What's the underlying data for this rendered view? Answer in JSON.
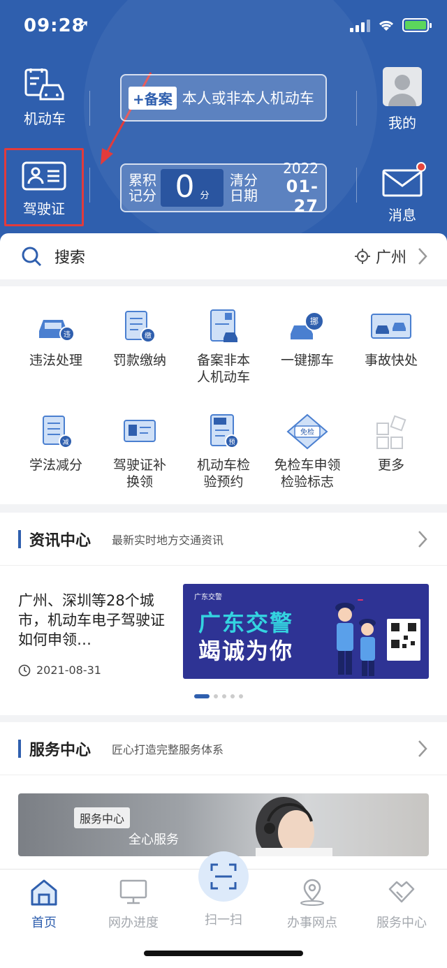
{
  "status_bar": {
    "time": "09:28"
  },
  "header": {
    "vehicle_label": "机动车",
    "license_label": "驾驶证",
    "register_tag": "+备案",
    "register_text": "本人或非本人机动车",
    "score_label_1": "累积",
    "score_label_2": "记分",
    "score_value": "0",
    "score_unit": "分",
    "clear_label_1": "清分",
    "clear_label_2": "日期",
    "clear_year": "2022",
    "clear_date": "01-27",
    "mine_label": "我的",
    "message_label": "消息"
  },
  "search": {
    "placeholder": "搜索",
    "city": "广州"
  },
  "services": [
    {
      "label": "违法处理",
      "icon": "car-violation-icon"
    },
    {
      "label": "罚款缴纳",
      "icon": "fine-payment-icon"
    },
    {
      "label": "备案非本人机动车",
      "icon": "register-vehicle-icon"
    },
    {
      "label": "一键挪车",
      "icon": "move-car-icon"
    },
    {
      "label": "事故快处",
      "icon": "accident-icon"
    },
    {
      "label": "学法减分",
      "icon": "study-reduce-icon"
    },
    {
      "label": "驾驶证补换领",
      "icon": "license-replace-icon"
    },
    {
      "label": "机动车检验预约",
      "icon": "inspection-booking-icon"
    },
    {
      "label": "免检车申领检验标志",
      "icon": "exempt-sticker-icon"
    },
    {
      "label": "更多",
      "icon": "more-icon"
    }
  ],
  "news": {
    "title": "资讯中心",
    "subtitle": "最新实时地方交通资讯",
    "headline": "广州、深圳等28个城市，机动车电子驾驶证如何申领…",
    "date": "2021-08-31",
    "banner_small": "广东交警",
    "banner_line1": "广东交警",
    "banner_line2": "竭诚为你"
  },
  "service_center": {
    "title": "服务中心",
    "subtitle": "匠心打造完整服务体系",
    "banner_tag": "服务中心",
    "banner_text": "全心服务"
  },
  "tabbar": {
    "home": "首页",
    "progress": "网办进度",
    "scan": "扫一扫",
    "outlets": "办事网点",
    "service": "服务中心"
  },
  "colors": {
    "primary": "#2f5fae",
    "alert": "#e23b3b",
    "accent": "#34d3e0"
  }
}
